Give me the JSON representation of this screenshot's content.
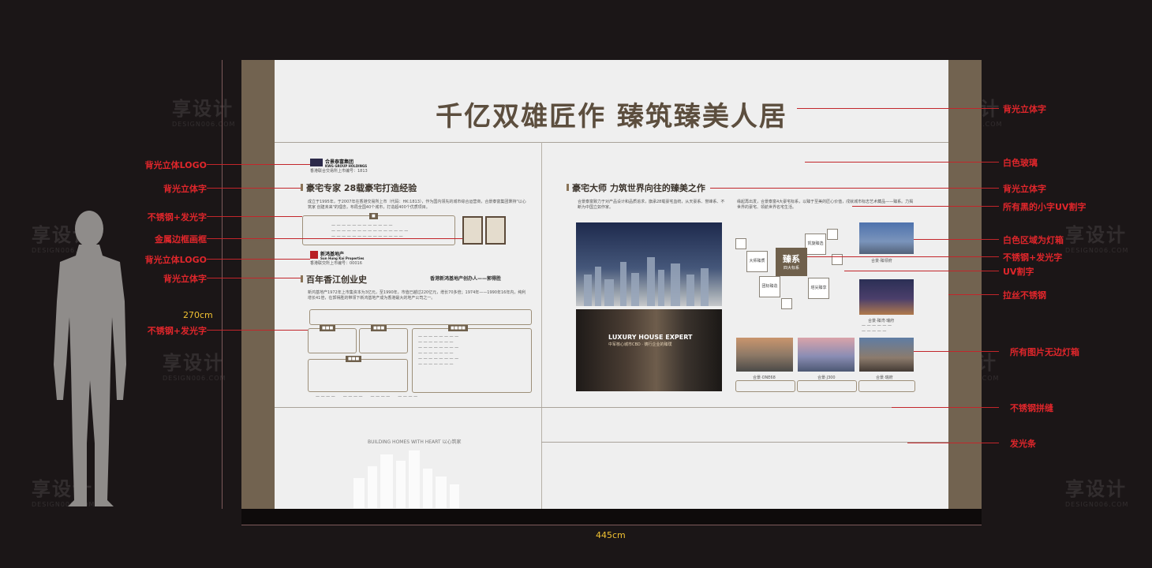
{
  "watermark": {
    "brand": "享设计",
    "site": "DESIGN006.COM"
  },
  "board": {
    "title": "千亿双雄匠作  臻筑臻美人居",
    "left": {
      "logo1_name": "合景泰富集团",
      "logo1_sub": "KWG GROUP HOLDINGS",
      "logo1_code": "香港联合交易所上市编号：1813",
      "heading1": "豪宅专家  28载豪宅打造经验",
      "intro1": "成立于1995年，于2007年在香港交易所上市（代码：HK:1813），作为国内领先的城市综合运营商，合景泰富集团秉持\"以心筑家 创建未来\"的理念，布局全国40个城市，打造超400个优质项目。",
      "logo2_name": "新鸿基地产",
      "logo2_sub": "Sun Hung Kai Properties",
      "logo2_code": "香港联交所上市编号：00016",
      "heading2": "百年香江创业史",
      "subheading2": "香港新鸿基地产创办人——郭得胜",
      "intro2": "新鸿基地产1972年上市集资本为3亿元，至1990年，市值已越过220亿元，增长70多倍；1974年——1990年16年内，纯利增长41倍，在郭得胜的带领下新鸿基地产成为香港最大的地产公司之一。",
      "bottom_caption": "BUILDING HOMES WITH HEART  以心筑家"
    },
    "right": {
      "heading": "豪宅大师  力筑世界向往的臻美之作",
      "intro": "合景泰富致力于对产品设计和品质追求，旗承28载豪宅血统，从天豪系、誉峰系、不断为中国立如作家。",
      "intro2": "缘起再出发，合景泰富4大豪宅标系，以臻于至美的匠心价值，戍就城市标志艺术藏品——臻系。力揭世界的豪宅、领航世界名宅生活。",
      "luxury_title": "LUXURY HOUSE EXPERT",
      "luxury_sub": "中军核心城市CBD · 铸行企业的臻璞",
      "diagram_center": "臻系",
      "diagram_center_sub": "四大标系",
      "nodes": [
        "大师臻质",
        "凯旋臻选",
        "团标臻造",
        "塔尖臻享"
      ],
      "captions": [
        "合景·ONE68",
        "合景·J300",
        "合景·瑞府"
      ],
      "side_captions": [
        "合景·臻领府",
        "合景·臻湾·瑞府"
      ]
    }
  },
  "annotations_left": [
    "背光立体LOGO",
    "背光立体字",
    "不锈钢+发光字",
    "金属边框画框",
    "背光立体LOGO",
    "背光立体字",
    "不锈钢+发光字"
  ],
  "annotations_right": [
    "背光立体字",
    "白色玻璃",
    "背光立体字",
    "所有黑的小字UV割字",
    "白色区域为灯箱",
    "不锈钢+发光字",
    "UV割字",
    "拉丝不锈钢",
    "所有图片无边灯箱",
    "不锈钢拼缝",
    "发光条"
  ],
  "dimensions": {
    "height": "270cm",
    "width": "445cm"
  },
  "colors": {
    "bg": "#1b1617",
    "board": "#efefef",
    "pillar": "#726350",
    "accent": "#e0262b",
    "dim": "#f1c232"
  }
}
